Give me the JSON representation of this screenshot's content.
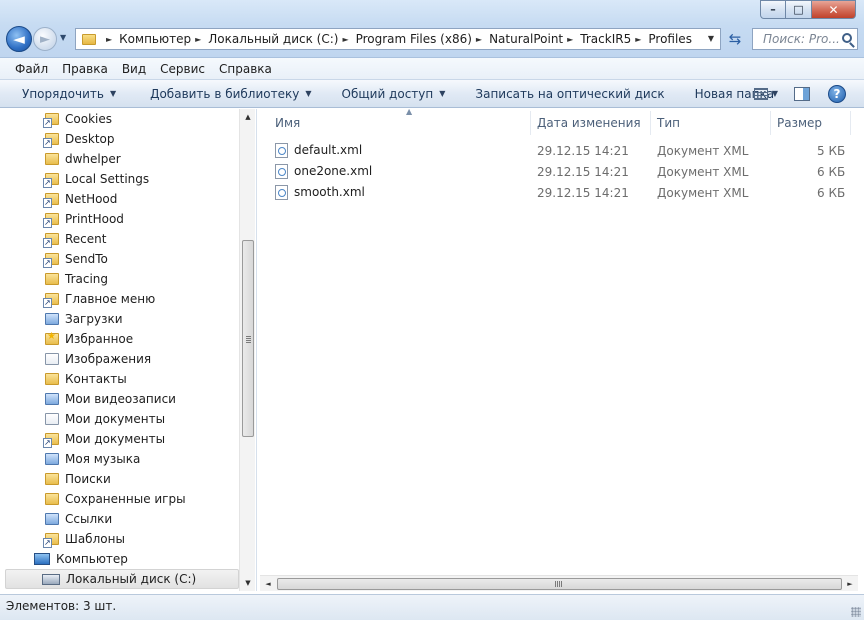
{
  "window": {
    "controls": {
      "minimize": "–",
      "maximize": "□",
      "close": "✕"
    }
  },
  "nav": {
    "back": "◄",
    "forward": "►",
    "history": "▼"
  },
  "address": {
    "crumbs": [
      "Компьютер",
      "Локальный диск (C:)",
      "Program Files (x86)",
      "NaturalPoint",
      "TrackIR5",
      "Profiles"
    ],
    "separator": "►",
    "dropdown": "▼"
  },
  "refresh_glyph": "⇆",
  "search": {
    "placeholder": "Поиск: Pro..."
  },
  "menubar": [
    "Файл",
    "Правка",
    "Вид",
    "Сервис",
    "Справка"
  ],
  "commandbar": {
    "organize": "Упорядочить",
    "add_to_library": "Добавить в библиотеку",
    "share": "Общий доступ",
    "burn": "Записать на оптический диск",
    "new_folder": "Новая папка",
    "arrow": "▼",
    "help": "?"
  },
  "tree": {
    "items": [
      {
        "label": "Cookies",
        "icon": "folder-link-icon"
      },
      {
        "label": "Desktop",
        "icon": "folder-link-icon"
      },
      {
        "label": "dwhelper",
        "icon": "folder-icon"
      },
      {
        "label": "Local Settings",
        "icon": "folder-link-icon"
      },
      {
        "label": "NetHood",
        "icon": "folder-link-icon"
      },
      {
        "label": "PrintHood",
        "icon": "folder-link-icon"
      },
      {
        "label": "Recent",
        "icon": "folder-link-icon"
      },
      {
        "label": "SendTo",
        "icon": "folder-link-icon"
      },
      {
        "label": "Tracing",
        "icon": "folder-icon"
      },
      {
        "label": "Главное меню",
        "icon": "folder-link-icon"
      },
      {
        "label": "Загрузки",
        "icon": "downloads-folder-icon"
      },
      {
        "label": "Избранное",
        "icon": "favorites-folder-icon"
      },
      {
        "label": "Изображения",
        "icon": "pictures-folder-icon"
      },
      {
        "label": "Контакты",
        "icon": "contacts-folder-icon"
      },
      {
        "label": "Мои видеозаписи",
        "icon": "videos-folder-icon"
      },
      {
        "label": "Мои документы",
        "icon": "documents-folder-icon"
      },
      {
        "label": "Мои документы",
        "icon": "folder-link-icon"
      },
      {
        "label": "Моя музыка",
        "icon": "music-folder-icon"
      },
      {
        "label": "Поиски",
        "icon": "searches-folder-icon"
      },
      {
        "label": "Сохраненные игры",
        "icon": "saved-games-folder-icon"
      },
      {
        "label": "Ссылки",
        "icon": "links-folder-icon"
      },
      {
        "label": "Шаблоны",
        "icon": "folder-link-icon"
      },
      {
        "label": "Компьютер",
        "icon": "computer-icon"
      },
      {
        "label": "Локальный диск (C:)",
        "icon": "drive-icon"
      }
    ],
    "scroll_up": "▲",
    "scroll_down": "▼"
  },
  "columns": {
    "name": "Имя",
    "date": "Дата изменения",
    "type": "Тип",
    "size": "Размер",
    "sort_indicator": "▲"
  },
  "files": [
    {
      "name": "default.xml",
      "date": "29.12.15 14:21",
      "type": "Документ XML",
      "size": "5 КБ"
    },
    {
      "name": "one2one.xml",
      "date": "29.12.15 14:21",
      "type": "Документ XML",
      "size": "6 КБ"
    },
    {
      "name": "smooth.xml",
      "date": "29.12.15 14:21",
      "type": "Документ XML",
      "size": "6 КБ"
    }
  ],
  "hscroll": {
    "left": "◄",
    "right": "►"
  },
  "statusbar": {
    "text": "Элементов: 3 шт."
  }
}
